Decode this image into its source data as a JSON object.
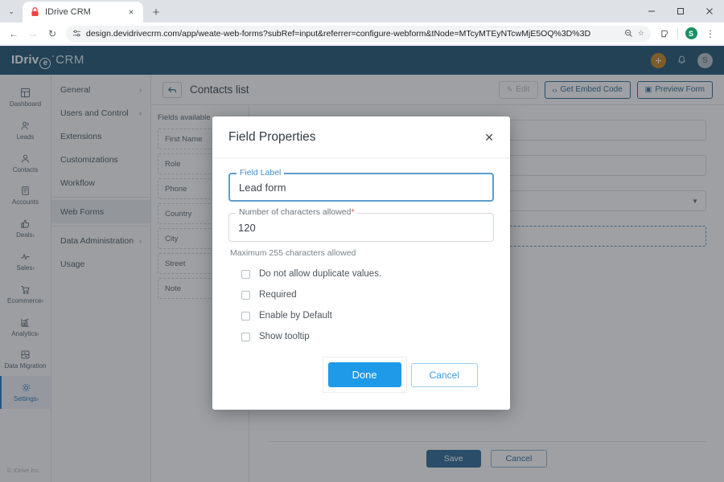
{
  "browser": {
    "tab": {
      "title": "IDrive CRM",
      "favicon": "idrive-lock-icon",
      "close": "×"
    },
    "new_tab": "+",
    "tab_list_icon": "⌄",
    "window": {
      "minimize": "—",
      "maximize": "☐",
      "close": "✕"
    },
    "nav": {
      "back": "←",
      "forward": "→",
      "reload": "↻"
    },
    "omnibox": {
      "site_icon": "site-settings-icon",
      "url": "design.devidrivecrm.com/app/weate-web-forms?subRef=input&referrer=configure-webform&tNode=MTcyMTEyNTcwMjE5OQ%3D%3D",
      "zoom_icon": "🔍",
      "bookmark_icon": "☆"
    },
    "toolbar": {
      "extensions_icon": "⧉",
      "profile_initial": "S",
      "menu_icon": "⋮"
    }
  },
  "topbar": {
    "logo": {
      "brand": "IDriv",
      "circle_letter": "e",
      "degree": "°",
      "suffix": "CRM"
    },
    "add_label": "+",
    "bell_icon": "🔔",
    "avatar_initial": "S"
  },
  "rail": {
    "items": [
      {
        "label": "Dashboard",
        "icon": "dashboard-icon",
        "glyph": "⊞",
        "caret": "",
        "active": false
      },
      {
        "label": "Leads",
        "icon": "leads-icon",
        "glyph": "⚯",
        "caret": "",
        "active": false
      },
      {
        "label": "Contacts",
        "icon": "contacts-icon",
        "glyph": "○",
        "caret": "",
        "active": false
      },
      {
        "label": "Accounts",
        "icon": "accounts-icon",
        "glyph": "▤",
        "caret": "",
        "active": false
      },
      {
        "label": "Deals",
        "icon": "deals-icon",
        "glyph": "☝",
        "caret": "›",
        "active": false
      },
      {
        "label": "Sales",
        "icon": "sales-icon",
        "glyph": "⌇",
        "caret": "›",
        "active": false
      },
      {
        "label": "Ecommerce",
        "icon": "cart-icon",
        "glyph": "♑",
        "caret": "›",
        "active": false
      },
      {
        "label": "Analytics",
        "icon": "analytics-icon",
        "glyph": "◥",
        "caret": "›",
        "active": false
      },
      {
        "label": "Data Migration",
        "icon": "data-migration-icon",
        "glyph": "⎓",
        "caret": "",
        "active": false
      },
      {
        "label": "Settings",
        "icon": "gear-icon",
        "glyph": "⚙",
        "caret": "›",
        "active": true
      }
    ]
  },
  "subnav": {
    "items": [
      {
        "label": "General",
        "caret": "›",
        "active": false
      },
      {
        "label": "Users and Control",
        "caret": "›",
        "active": false
      },
      {
        "label": "Extensions",
        "caret": "",
        "active": false
      },
      {
        "label": "Customizations",
        "caret": "",
        "active": false
      },
      {
        "label": "Workflow",
        "caret": "",
        "active": false
      },
      {
        "label": "Web Forms",
        "caret": "",
        "active": true
      },
      {
        "label": "Data Administration",
        "caret": "›",
        "active": false
      },
      {
        "label": "Usage",
        "caret": "",
        "active": false
      }
    ]
  },
  "content": {
    "back_icon": "↩",
    "title": "Contacts list",
    "actions": [
      {
        "label": "Edit",
        "icon": "pencil-icon",
        "glyph": "✎",
        "disabled": true
      },
      {
        "label": "Get Embed Code",
        "icon": "code-icon",
        "glyph": "‹›",
        "disabled": false
      },
      {
        "label": "Preview Form",
        "icon": "preview-icon",
        "glyph": "▣",
        "disabled": false
      }
    ],
    "fields_title": "Fields available",
    "fields": [
      "First Name",
      "Role",
      "Phone",
      "Country",
      "City",
      "Street",
      "Note"
    ],
    "canvas": {
      "select_caret": "▼",
      "dropzone_label": ""
    },
    "footer": {
      "save_label": "Save",
      "cancel_label": "Cancel"
    },
    "copyright": "© IDrive Inc."
  },
  "modal": {
    "title": "Field Properties",
    "close_icon": "✕",
    "field_label": {
      "legend": "Field Label",
      "value": "Lead form",
      "required": ""
    },
    "char_limit": {
      "legend": "Number of characters allowed",
      "required": "*",
      "value": "120"
    },
    "helper": "Maximum 255 characters allowed",
    "checkboxes": [
      {
        "label": "Do not allow duplicate values.",
        "checked": false
      },
      {
        "label": "Required",
        "checked": false
      },
      {
        "label": "Enable by Default",
        "checked": false
      },
      {
        "label": "Show tooltip",
        "checked": false
      }
    ],
    "done_label": "Done",
    "cancel_label": "Cancel"
  },
  "colors": {
    "topbar": "#1f5573",
    "accent_blue": "#2c6a96",
    "primary_button": "#1e9ae8",
    "add_button": "#c8861e",
    "required_red": "#e05a5a"
  }
}
